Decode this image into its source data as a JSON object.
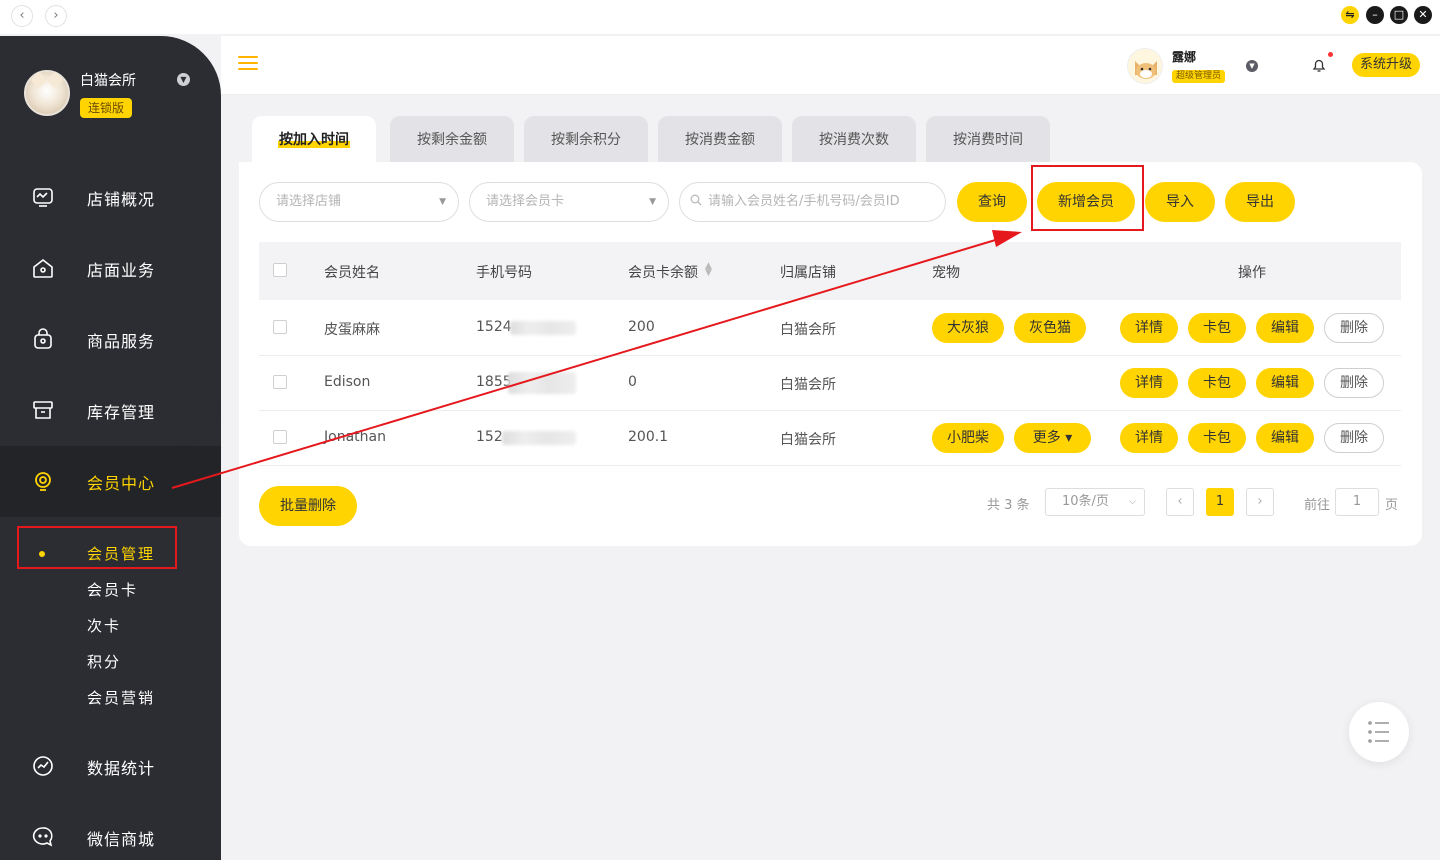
{
  "sidebar": {
    "shop_name": "白猫会所",
    "shop_badge": "连锁版",
    "menu": [
      {
        "label": "店铺概况",
        "icon": "monitor-icon"
      },
      {
        "label": "店面业务",
        "icon": "house-icon"
      },
      {
        "label": "商品服务",
        "icon": "bag-icon"
      },
      {
        "label": "库存管理",
        "icon": "box-icon"
      },
      {
        "label": "会员中心",
        "icon": "member-icon"
      },
      {
        "label": "数据统计",
        "icon": "chart-icon"
      },
      {
        "label": "微信商城",
        "icon": "chat-icon"
      }
    ],
    "submenu": [
      "会员管理",
      "会员卡",
      "次卡",
      "积分",
      "会员营销"
    ]
  },
  "header": {
    "user_name": "露娜",
    "user_role": "超级管理员",
    "upgrade_label": "系统升级"
  },
  "tabs": [
    "按加入时间",
    "按剩余金额",
    "按剩余积分",
    "按消费金额",
    "按消费次数",
    "按消费时间"
  ],
  "filters": {
    "shop_placeholder": "请选择店铺",
    "card_placeholder": "请选择会员卡",
    "search_placeholder": "请输入会员姓名/手机号码/会员ID"
  },
  "actions": {
    "query": "查询",
    "add": "新增会员",
    "import": "导入",
    "export": "导出",
    "batch_delete": "批量删除"
  },
  "table": {
    "headers": [
      "会员姓名",
      "手机号码",
      "会员卡余额",
      "归属店铺",
      "宠物",
      "操作"
    ],
    "rows": [
      {
        "name": "皮蛋麻麻",
        "phone": "1524",
        "balance": "200",
        "store": "白猫会所",
        "pets": [
          "大灰狼",
          "灰色猫"
        ]
      },
      {
        "name": "Edison",
        "phone": "1855",
        "balance": "0",
        "store": "白猫会所",
        "pets": []
      },
      {
        "name": "Jonathan",
        "phone": "152",
        "balance": "200.1",
        "store": "白猫会所",
        "pets": [
          "小肥柴",
          "更多 ▾"
        ]
      }
    ],
    "row_actions": [
      "详情",
      "卡包",
      "编辑",
      "删除"
    ]
  },
  "pager": {
    "total": "共 3 条",
    "page_size": "10条/页",
    "current": "1",
    "goto_label": "前往",
    "goto_value": "1",
    "page_unit": "页",
    "prev": "‹",
    "next": "›"
  },
  "colors": {
    "accent": "#ffd400",
    "sidebar": "#2c2d33",
    "annotation": "#e5191d"
  }
}
